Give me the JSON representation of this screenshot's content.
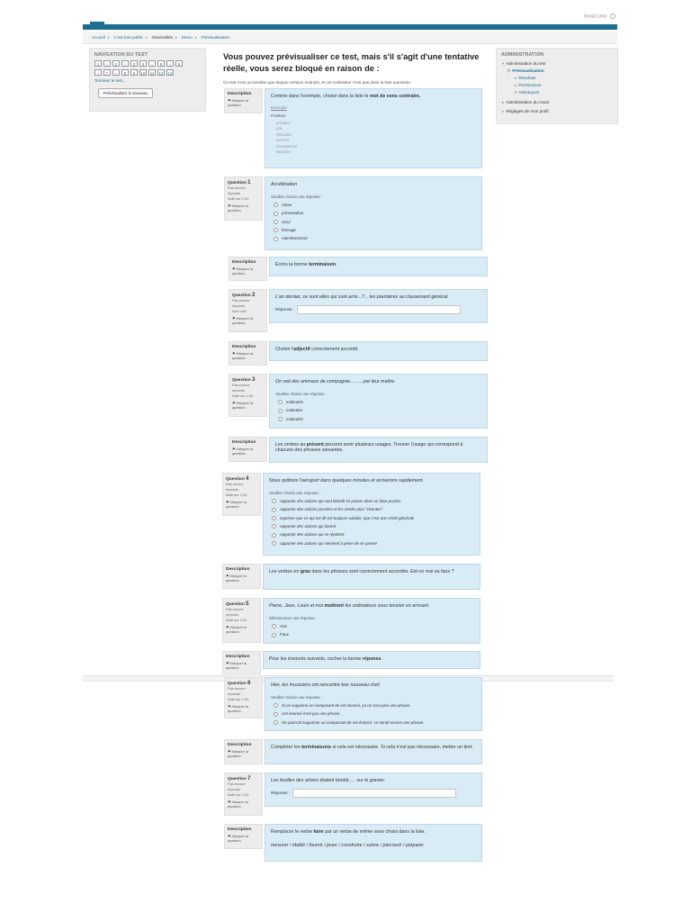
{
  "header": {
    "user_name": "Sonia Lima"
  },
  "breadcrumb": {
    "items": [
      "Accueil",
      "C'est tout public",
      "Généralités",
      "Demo",
      "Prévisualisation"
    ]
  },
  "nav_block": {
    "title": "NAVIGATION DU TEST",
    "row1": [
      "1",
      "i",
      "2",
      "i",
      "3",
      "4",
      "i",
      "5",
      "i",
      "6"
    ],
    "row2": [
      "i",
      "7",
      "i",
      "8",
      "9",
      "10",
      "11",
      "12",
      "13"
    ],
    "finish_link": "Terminer le test...",
    "preview_again_button": "Prévisualiser à nouveau"
  },
  "admin_block": {
    "title": "ADMINISTRATION",
    "items": [
      {
        "label": "Administration du test",
        "level": 1
      },
      {
        "label": "Prévisualisation",
        "level": 2
      },
      {
        "label": "Résultats",
        "level": 3
      },
      {
        "label": "Permissions",
        "level": 3
      },
      {
        "label": "Historiques",
        "level": 3
      },
      {
        "label": "Administration du cours",
        "level": 1
      },
      {
        "label": "Réglages de mon profil",
        "level": 1
      }
    ]
  },
  "page": {
    "title": "Vous pouvez prévisualiser ce test, mais s'il s'agit d'une tentative réelle, vous serez bloqué en raison de :",
    "note": "Ce test n'est accessible que depuis certains endroits, et cet ordinateur n'est pas dans la liste autorisée."
  },
  "labels": {
    "description": "Description",
    "flag": "Marquer la question",
    "question_prefix": "Question",
    "reponse": "Réponse :"
  },
  "desc1": {
    "text_pre": "Comme dans l'exemple, choisir dans la liste le ",
    "text_bold": "mot de sens contraire.",
    "example_link": "Exemple",
    "example_word": "Punition",
    "example_list": [
      "privation",
      "prix",
      "Réciation",
      "cuisson",
      "récompense",
      "sanction"
    ]
  },
  "q1": {
    "number": "1",
    "state": "Pas encore répondu",
    "mark": "Noté sur 1,00",
    "prompt": "Accélération",
    "hint": "Veuillez choisir une réponse :",
    "options": [
      "retour",
      "présentation",
      "recul",
      "freinage",
      "ralentissement"
    ]
  },
  "desc2": {
    "pre": "Écrire la bonne ",
    "bold": "terminaison",
    "post": "."
  },
  "q2": {
    "number": "2",
    "state": "Pas encore répondu",
    "mark": "Non noté",
    "prompt": "L'an dernier, ce sont elles qui sont arriv...?... les premières au classement général."
  },
  "desc3": {
    "pre": "Choisir l'",
    "bold": "adjectif",
    "post": " correctement accordé."
  },
  "q3": {
    "number": "3",
    "state": "Pas encore répondu",
    "mark": "Noté sur 1,00",
    "prompt": "On voit des animaux de compagnie..........par leur maître.",
    "hint": "Veuillez choisir une réponse :",
    "options": [
      "maltraités",
      "maltraiter",
      "maltraités"
    ]
  },
  "desc4": {
    "pre": "Les verbes au ",
    "bold": "présent",
    "post": " peuvent avoir plusieurs usages. Trouver l'usage qui correspond à chacune des phrases suivantes."
  },
  "q4": {
    "number": "4",
    "state": "Pas encore répondu",
    "mark": "Noté sur 1,00",
    "prompt": "Nous quittons l'aéroport dans quelques minutes et arriverons rapidement.",
    "hint": "Veuillez choisir une réponse :",
    "options": [
      "rapporter des actions qui vont bientôt se passer dans un futur proche.",
      "rapporter des actions passées et les rendre plus \"vivantes\"",
      "exprimer que ce qui est dit est toujours valable, que c'est une vérité générale",
      "rapporter des actions qui durent",
      "rapporter des actions qui se répètent",
      "rapporter des actions qui viennent à peine de se passer"
    ]
  },
  "desc5": {
    "pre": "Les verbes en ",
    "bold": "gras",
    "post": " dans les phrases sont correctement accordés. Est-ce vrai ou faux ?"
  },
  "q5": {
    "number": "5",
    "state": "Pas encore répondu",
    "mark": "Noté sur 1,00",
    "prompt_pre": "Pierre, Jean, Louis et moi ",
    "prompt_bold": "mettront",
    "prompt_post": " les ordinateurs sous tension en arrivant.",
    "hint": "Sélectionnez une réponse :",
    "options": [
      "Vrai",
      "Faux"
    ]
  },
  "desc6": {
    "pre": "Pour les énoncés suivants, cocher la bonne ",
    "bold": "réponse",
    "post": "."
  },
  "q6": {
    "number": "6",
    "state": "Pas encore répondu",
    "mark": "Noté sur 1,00",
    "prompt": "Hier, les musiciens ont rencontré leur nouveau chef.",
    "hint": "Veuillez choisir une réponse :",
    "options": [
      "Si on supprime un composant de cet énoncé, ça ne sera plus une phrase.",
      "Cet énoncé n'est pas une phrase.",
      "On pourrait supprimer un composant de cet énoncé, ce serait encore une phrase."
    ]
  },
  "desc7": {
    "pre": "Compléter les ",
    "bold": "terminaisons",
    "post": " si cela est nécessaire. Si cela n'est pas nécessaire, mettre un tiret."
  },
  "q7": {
    "number": "7",
    "state": "Pas encore répondu",
    "mark": "Noté sur 1,00",
    "prompt": "Les feuilles des arbres étaient tombé..... sur le gravier."
  },
  "desc8": {
    "pre": "Remplacer le verbe ",
    "bold": "faire",
    "post": " par un verbe de même sens choisi dans la liste.",
    "list": "mesurer / établir / fournir / jouer / construire / suivre / parcourir / préparer"
  },
  "colors": {
    "accent": "#1d6d91",
    "content_bg": "#d9ecf6",
    "info_bg": "#ececec"
  }
}
